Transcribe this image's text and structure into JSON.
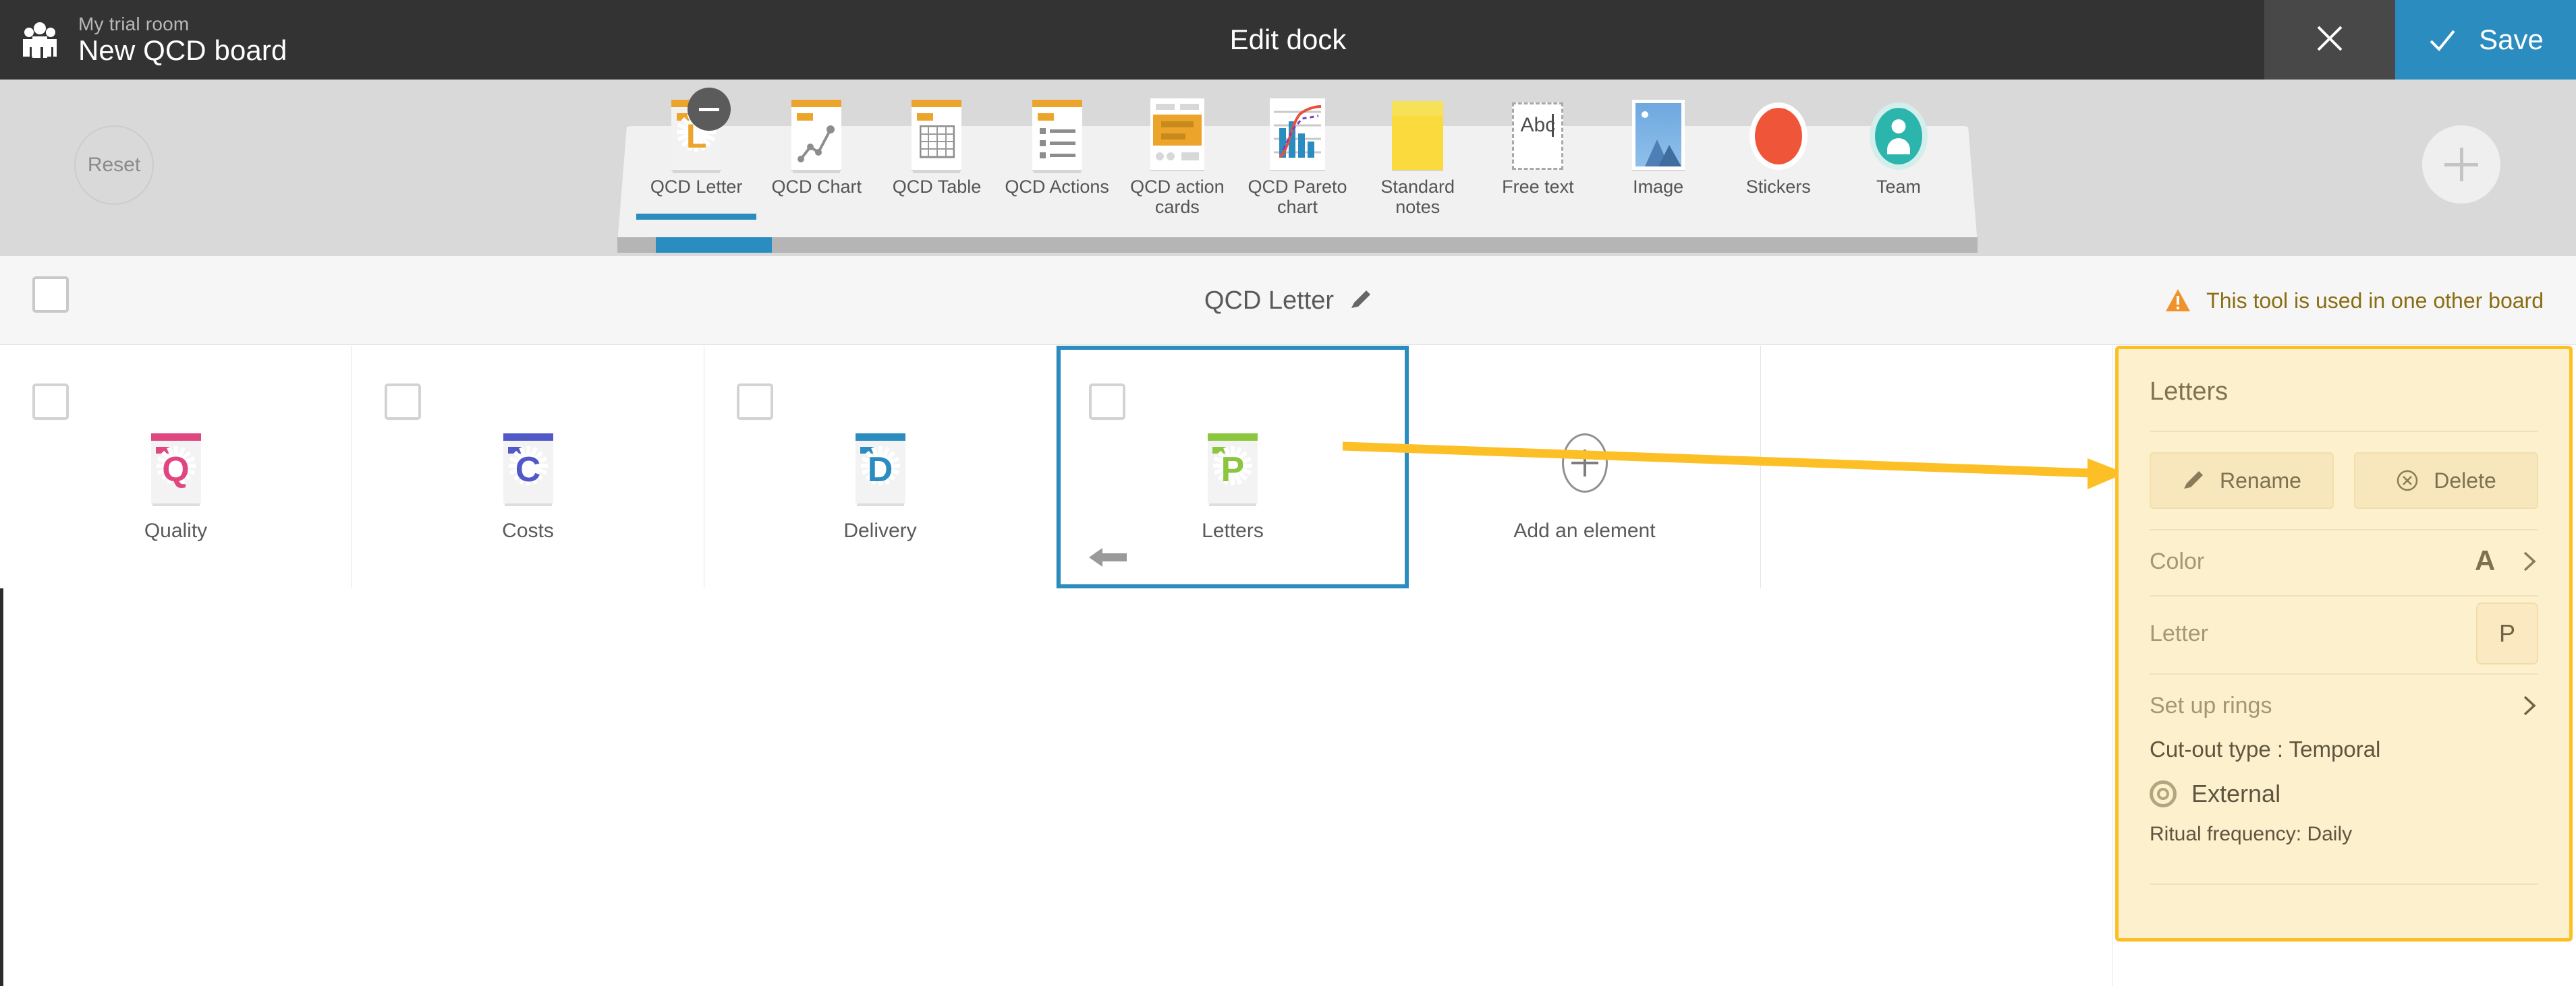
{
  "topbar": {
    "room_name": "My trial room",
    "board_name": "New QCD board",
    "title": "Edit dock",
    "close_icon": "close-icon",
    "save_label": "Save",
    "save_icon": "check-icon"
  },
  "dock": {
    "reset_label": "Reset",
    "add_icon": "plus-icon",
    "tools": [
      {
        "label": "QCD Letter",
        "icon": "qcd-letter-icon",
        "active": true,
        "badge": "minus-badge"
      },
      {
        "label": "QCD Chart",
        "icon": "qcd-chart-icon",
        "active": false,
        "badge": ""
      },
      {
        "label": "QCD Table",
        "icon": "qcd-table-icon",
        "active": false,
        "badge": ""
      },
      {
        "label": "QCD Actions",
        "icon": "qcd-actions-icon",
        "active": false,
        "badge": ""
      },
      {
        "label": "QCD action cards",
        "icon": "qcd-action-cards-icon",
        "active": false,
        "badge": ""
      },
      {
        "label": "QCD Pareto chart",
        "icon": "qcd-pareto-chart-icon",
        "active": false,
        "badge": ""
      },
      {
        "label": "Standard notes",
        "icon": "standard-notes-icon",
        "active": false,
        "badge": ""
      },
      {
        "label": "Free text",
        "icon": "free-text-icon",
        "free_text_sample": "Abc",
        "active": false,
        "badge": ""
      },
      {
        "label": "Image",
        "icon": "image-icon",
        "active": false,
        "badge": ""
      },
      {
        "label": "Stickers",
        "icon": "stickers-icon",
        "active": false,
        "badge": ""
      },
      {
        "label": "Team",
        "icon": "team-icon",
        "active": false,
        "badge": ""
      }
    ]
  },
  "subheader": {
    "title": "QCD Letter",
    "edit_icon": "pencil-icon",
    "warning_icon": "warning-triangle-icon",
    "warning_text": "This tool is used in one other board"
  },
  "elements": [
    {
      "label": "Quality",
      "letter": "Q",
      "color": "#e0467f",
      "selected": false
    },
    {
      "label": "Costs",
      "letter": "C",
      "color": "#5158c8",
      "selected": false
    },
    {
      "label": "Delivery",
      "letter": "D",
      "color": "#2b8cc0",
      "selected": false
    },
    {
      "label": "Letters",
      "letter": "P",
      "color": "#8cc63f",
      "selected": true
    }
  ],
  "add_element": {
    "label": "Add an element",
    "icon": "plus-circle-icon"
  },
  "panel": {
    "title": "Letters",
    "rename_label": "Rename",
    "rename_icon": "pencil-icon",
    "delete_label": "Delete",
    "delete_icon": "circle-x-icon",
    "color_label": "Color",
    "color_icon": "font-color-icon",
    "color_swatch": "#aecd4e",
    "color_chevron": "chevron-right-icon",
    "letter_label": "Letter",
    "letter_value": "P",
    "rings_label": "Set up rings",
    "rings_chevron": "chevron-right-icon",
    "cutout_text": "Cut-out type : Temporal",
    "external_label": "External",
    "external_icon": "target-rings-icon",
    "ritual_text": "Ritual frequency: Daily"
  },
  "colors": {
    "accent_blue": "#2b8cc0",
    "panel_border": "#fcbf26",
    "panel_bg": "#fdf0cd",
    "topbar_bg": "#333333",
    "dock_bg": "#d9d9d9",
    "warning": "#8a6d13",
    "orange": "#eda42a"
  }
}
